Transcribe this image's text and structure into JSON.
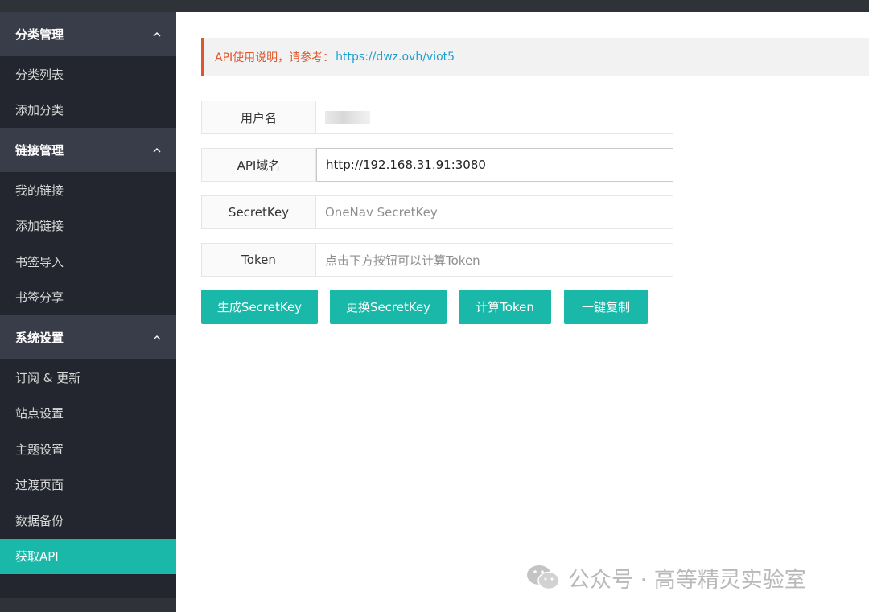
{
  "sidebar": {
    "groups": [
      {
        "title": "分类管理",
        "items": [
          "分类列表",
          "添加分类"
        ]
      },
      {
        "title": "链接管理",
        "items": [
          "我的链接",
          "添加链接",
          "书签导入",
          "书签分享"
        ]
      },
      {
        "title": "系统设置",
        "items": [
          "订阅 & 更新",
          "站点设置",
          "主题设置",
          "过渡页面",
          "数据备份",
          "获取API"
        ]
      }
    ],
    "active_item": "获取API"
  },
  "notice": {
    "text": "API使用说明，请参考：",
    "link": "https://dwz.ovh/viot5"
  },
  "form": {
    "username": {
      "label": "用户名",
      "value": ""
    },
    "api_domain": {
      "label": "API域名",
      "value": "http://192.168.31.91:3080"
    },
    "secret_key": {
      "label": "SecretKey",
      "placeholder": "OneNav SecretKey"
    },
    "token": {
      "label": "Token",
      "placeholder": "点击下方按钮可以计算Token"
    }
  },
  "buttons": {
    "generate": "生成SecretKey",
    "change": "更换SecretKey",
    "compute": "计算Token",
    "copy": "一键复制"
  },
  "watermark": "公众号 · 高等精灵实验室",
  "colors": {
    "accent": "#1ab8a8",
    "notice": "#e0562b",
    "link": "#1e9fd2",
    "sidebar": "#23262e"
  }
}
